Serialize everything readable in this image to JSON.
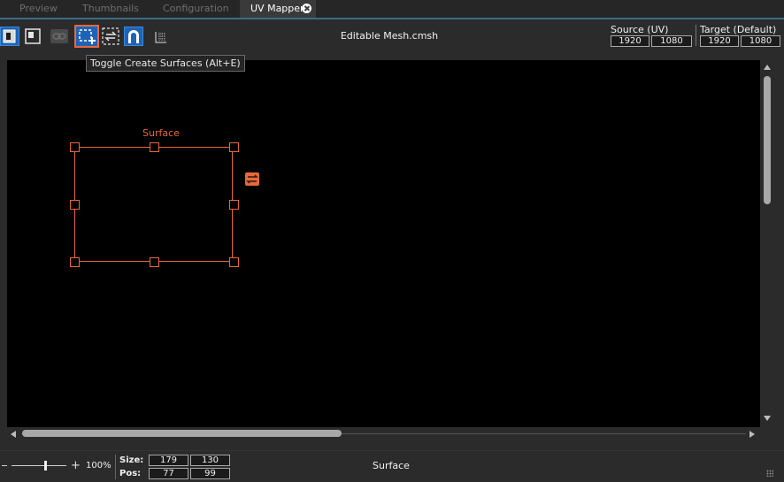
{
  "tabs": [
    {
      "label": "Preview",
      "active": false
    },
    {
      "label": "Thumbnails",
      "active": false
    },
    {
      "label": "Configuration",
      "active": false
    },
    {
      "label": "UV Mapper",
      "active": true
    }
  ],
  "toolbar": {
    "title": "Editable Mesh.cmsh",
    "tools": [
      {
        "icon": "select-mode-icon",
        "active": true
      },
      {
        "icon": "page-frame-icon",
        "active": false
      },
      {
        "icon": "disabled-link-icon",
        "active": false
      },
      {
        "icon": "create-surface-icon",
        "active": true
      },
      {
        "icon": "swap-surface-icon",
        "active": false
      },
      {
        "icon": "magnet-icon",
        "active": true
      },
      {
        "icon": "grid-icon",
        "active": false
      }
    ],
    "source": {
      "label": "Source (UV)",
      "width": "1920",
      "height": "1080"
    },
    "target": {
      "label": "Target (Default)",
      "width": "1920",
      "height": "1080"
    }
  },
  "tooltip": "Toggle Create Surfaces (Alt+E)",
  "viewport": {
    "surface_label": "Surface"
  },
  "status": {
    "zoom": "100%",
    "size_label": "Size:",
    "size_w": "179",
    "size_h": "130",
    "pos_label": "Pos:",
    "pos_x": "77",
    "pos_y": "99",
    "selection_name": "Surface"
  },
  "colors": {
    "accent": "#e8683d",
    "active_tool": "#1e63b8",
    "tab_underline": "#3d6a86"
  }
}
